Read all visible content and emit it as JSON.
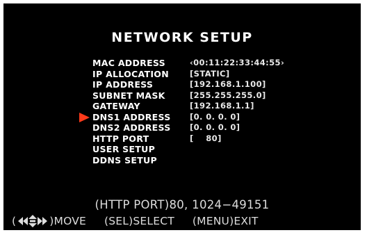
{
  "title": "NETWORK SETUP",
  "menu": [
    {
      "label": "MAC ADDRESS",
      "value": "‹00:11:22:33:44:55›"
    },
    {
      "label": "IP ALLOCATION",
      "value": "[STATIC]"
    },
    {
      "label": "IP ADDRESS",
      "value": "[192.168.1.100]"
    },
    {
      "label": "SUBNET MASK",
      "value": "[255.255.255.0]"
    },
    {
      "label": "GATEWAY",
      "value": "[192.168.1.1]"
    },
    {
      "label": "DNS1 ADDRESS",
      "value": "[0. 0. 0. 0]"
    },
    {
      "label": "DNS2 ADDRESS",
      "value": "[0. 0. 0. 0]"
    },
    {
      "label": "HTTP PORT",
      "value": "[    80]"
    },
    {
      "label": "USER SETUP",
      "value": ""
    },
    {
      "label": "DDNS SETUP",
      "value": ""
    }
  ],
  "selected_index": 5,
  "hint": "(HTTP PORT)80, 1024−49151",
  "footer": {
    "move_prefix": "(",
    "move_suffix": ")MOVE",
    "select": "(SEL)SELECT",
    "exit": "(MENU)EXIT"
  },
  "colors": {
    "background": "#000000",
    "text": "#ffffff",
    "selection_arrow": "#ff3a1a"
  },
  "icons": {
    "selection": "selection-arrow-icon",
    "navigation": "dpad-arrows-icon"
  }
}
